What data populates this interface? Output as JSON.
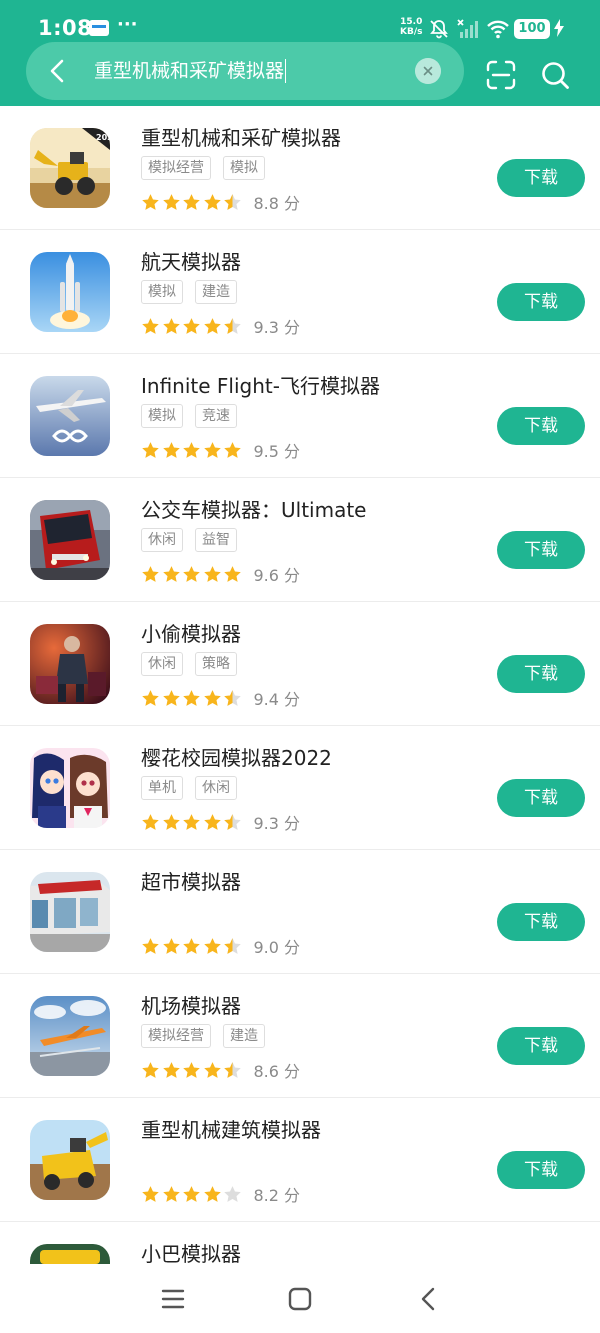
{
  "status_bar": {
    "time": "1:08",
    "overflow_dots": "···",
    "net_speed": "15.0",
    "net_unit": "KB/s",
    "battery": "100",
    "icons": [
      "message-icon",
      "mute-icon",
      "signal-icon",
      "wifi-icon",
      "battery-icon",
      "charging-icon"
    ]
  },
  "search": {
    "query": "重型机械和采矿模拟器",
    "back_icon": "back-arrow-icon",
    "clear_icon": "clear-icon",
    "scan_icon": "scan-icon",
    "search_icon": "search-icon"
  },
  "colors": {
    "accent": "#1fb592",
    "search_bg": "#4ccaa9",
    "star": "#f8b51c",
    "star_empty": "#dddddd",
    "tag_text": "#8a8a8a"
  },
  "results": [
    {
      "name": "重型机械和采矿模拟器",
      "tags": [
        "模拟经营",
        "模拟"
      ],
      "stars": 4.5,
      "score": "8.8 分",
      "button": "下载",
      "icon": "excavator-game-icon"
    },
    {
      "name": "航天模拟器",
      "tags": [
        "模拟",
        "建造"
      ],
      "stars": 4.5,
      "score": "9.3 分",
      "button": "下载",
      "icon": "rocket-game-icon"
    },
    {
      "name": "Infinite Flight-飞行模拟器",
      "tags": [
        "模拟",
        "竞速"
      ],
      "stars": 5,
      "score": "9.5 分",
      "button": "下载",
      "icon": "airplane-game-icon"
    },
    {
      "name": "公交车模拟器：Ultimate",
      "tags": [
        "休闲",
        "益智"
      ],
      "stars": 5,
      "score": "9.6 分",
      "button": "下载",
      "icon": "bus-game-icon"
    },
    {
      "name": "小偷模拟器",
      "tags": [
        "休闲",
        "策略"
      ],
      "stars": 4.5,
      "score": "9.4 分",
      "button": "下载",
      "icon": "thief-game-icon"
    },
    {
      "name": "樱花校园模拟器2022",
      "tags": [
        "单机",
        "休闲"
      ],
      "stars": 4.5,
      "score": "9.3 分",
      "button": "下载",
      "icon": "anime-school-game-icon"
    },
    {
      "name": "超市模拟器",
      "tags": [],
      "stars": 4.5,
      "score": "9.0 分",
      "button": "下载",
      "icon": "supermarket-game-icon"
    },
    {
      "name": "机场模拟器",
      "tags": [
        "模拟经营",
        "建造"
      ],
      "stars": 4.5,
      "score": "8.6 分",
      "button": "下载",
      "icon": "airport-game-icon"
    },
    {
      "name": "重型机械建筑模拟器",
      "tags": [],
      "stars": 4,
      "score": "8.2 分",
      "button": "下载",
      "icon": "construction-game-icon"
    },
    {
      "name": "小巴模拟器",
      "tags": [],
      "stars": 0,
      "score": "",
      "button": "",
      "icon": "minibus-game-icon"
    }
  ],
  "nav_bar": {
    "icons": [
      "menu-icon",
      "home-icon",
      "back-icon"
    ]
  }
}
